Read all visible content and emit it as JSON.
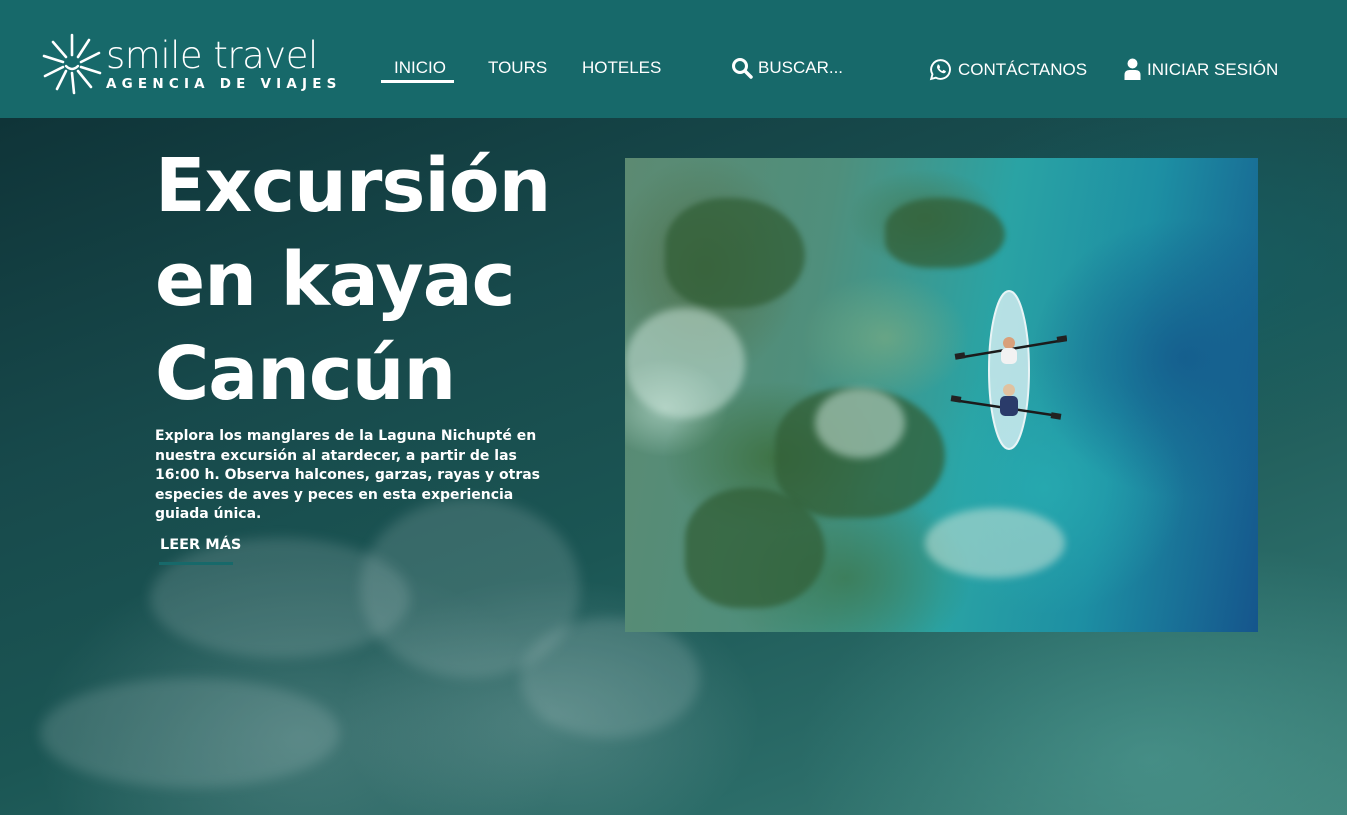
{
  "brand": {
    "name": "smile travel",
    "tagline": "AGENCIA DE VIAJES"
  },
  "nav": {
    "items": [
      {
        "label": "INICIO",
        "active": true
      },
      {
        "label": "TOURS"
      },
      {
        "label": "HOTELES"
      }
    ],
    "search_label": "BUSCAR...",
    "contact_label": "CONTÁCTANOS",
    "login_label": "INICIAR SESIÓN"
  },
  "hero": {
    "title_lines": [
      "Excursión",
      "en kayac",
      "Cancún"
    ],
    "description": "Explora los manglares de la Laguna Nichupté en nuestra excursión al atardecer, a partir de las 16:00 h. Observa halcones, garzas, rayas y otras especies de aves y peces en esta experiencia guiada única.",
    "cta_label": "LEER MÁS"
  },
  "colors": {
    "header_bg": "#17696a",
    "accent": "#17696a",
    "text": "#ffffff"
  },
  "icons": {
    "logo": "sunburst-logo-icon",
    "search": "search-icon",
    "contact": "whatsapp-icon",
    "login": "user-icon"
  }
}
